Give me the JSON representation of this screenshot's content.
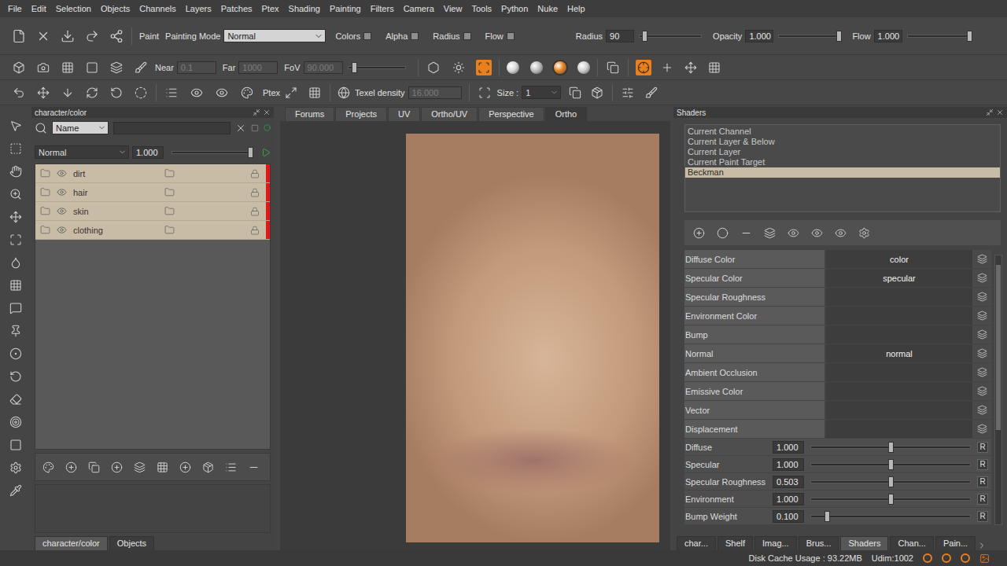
{
  "menu": [
    "File",
    "Edit",
    "Selection",
    "Objects",
    "Channels",
    "Layers",
    "Patches",
    "Ptex",
    "Shading",
    "Painting",
    "Filters",
    "Camera",
    "View",
    "Tools",
    "Python",
    "Nuke",
    "Help"
  ],
  "paint_bar": {
    "paint": "Paint",
    "mode_label": "Painting Mode",
    "mode_value": "Normal",
    "toggles": [
      {
        "label": "Colors",
        "checked": false
      },
      {
        "label": "Alpha",
        "checked": false
      },
      {
        "label": "Radius",
        "checked": false
      },
      {
        "label": "Flow",
        "checked": false
      }
    ],
    "sliders": [
      {
        "label": "Radius",
        "value": "90",
        "level": 0.08
      },
      {
        "label": "Opacity",
        "value": "1.000",
        "level": 0.97
      },
      {
        "label": "Flow",
        "value": "1.000",
        "level": 1.0
      }
    ]
  },
  "camera_bar": {
    "fields": [
      {
        "label": "Near",
        "value": "0.1",
        "disabled": true
      },
      {
        "label": "Far",
        "value": "1000",
        "disabled": true
      },
      {
        "label": "FoV",
        "value": "90.000",
        "disabled": true
      }
    ],
    "fov_level": 0.1,
    "view_modes": [
      {
        "active": false
      },
      {
        "active": false
      },
      {
        "active": true
      }
    ],
    "shading_balls": [
      {
        "color": "#d8d8d8",
        "selected": false
      },
      {
        "color": "#bdbdbd",
        "selected": false
      },
      {
        "color": "#e8801e",
        "selected": true
      },
      {
        "color": "#cfcfcf",
        "selected": false
      }
    ],
    "snap_tools": [
      {
        "active": true
      },
      {
        "active": false
      },
      {
        "active": false
      },
      {
        "active": false
      }
    ]
  },
  "ptex_bar": {
    "ptex": "Ptex",
    "texel_label": "Texel density",
    "texel_value": "16.000",
    "texel_disabled": true,
    "size_label": "Size :",
    "size_value": "1",
    "size_disabled": true
  },
  "layers_panel": {
    "title": "character/color",
    "filter": "Name",
    "search": "",
    "blend": "Normal",
    "opacity": "1.000",
    "opacity_level": 0.97,
    "layers": [
      {
        "name": "dirt",
        "visible": true,
        "locked": false,
        "selected": true
      },
      {
        "name": "hair",
        "visible": true,
        "locked": false,
        "selected": true
      },
      {
        "name": "skin",
        "visible": true,
        "locked": false,
        "selected": true
      },
      {
        "name": "clothing",
        "visible": true,
        "locked": false,
        "selected": true
      }
    ],
    "tabs": [
      {
        "label": "character/color",
        "selected": true
      },
      {
        "label": "Objects",
        "selected": false
      }
    ]
  },
  "viewport": {
    "tabs": [
      {
        "label": "Forums",
        "selected": false
      },
      {
        "label": "Projects",
        "selected": false
      },
      {
        "label": "UV",
        "selected": false
      },
      {
        "label": "Ortho/UV",
        "selected": false
      },
      {
        "label": "Perspective",
        "selected": false
      },
      {
        "label": "Ortho",
        "selected": true
      }
    ]
  },
  "shaders_panel": {
    "title": "Shaders",
    "targets": [
      {
        "label": "Current Channel",
        "selected": false
      },
      {
        "label": "Current Layer & Below",
        "selected": false
      },
      {
        "label": "Current Layer",
        "selected": false
      },
      {
        "label": "Current Paint Target",
        "selected": false
      },
      {
        "label": "Beckman",
        "selected": true
      }
    ],
    "properties": [
      {
        "label": "Diffuse Color",
        "value": "color"
      },
      {
        "label": "Specular Color",
        "value": "specular"
      },
      {
        "label": "Specular Roughness",
        "value": ""
      },
      {
        "label": "Environment Color",
        "value": ""
      },
      {
        "label": "Bump",
        "value": ""
      },
      {
        "label": "Normal",
        "value": "normal"
      },
      {
        "label": "Ambient Occlusion",
        "value": ""
      },
      {
        "label": "Emissive Color",
        "value": ""
      },
      {
        "label": "Vector",
        "value": ""
      },
      {
        "label": "Displacement",
        "value": ""
      }
    ],
    "sliders": [
      {
        "label": "Diffuse",
        "value": "1.000",
        "level": 0.5,
        "reset": "R"
      },
      {
        "label": "Specular",
        "value": "1.000",
        "level": 0.5,
        "reset": "R"
      },
      {
        "label": "Specular Roughness",
        "value": "0.503",
        "level": 0.5,
        "reset": "R"
      },
      {
        "label": "Environment",
        "value": "1.000",
        "level": 0.5,
        "reset": "R"
      },
      {
        "label": "Bump Weight",
        "value": "0.100",
        "level": 0.1,
        "reset": "R"
      }
    ]
  },
  "dock_tabs": [
    {
      "label": "char...",
      "selected": false
    },
    {
      "label": "Shelf",
      "selected": false
    },
    {
      "label": "Imag...",
      "selected": false
    },
    {
      "label": "Brus...",
      "selected": false
    },
    {
      "label": "Shaders",
      "selected": true
    },
    {
      "label": "Chan...",
      "selected": false
    },
    {
      "label": "Pain...",
      "selected": false
    }
  ],
  "status_bar": {
    "disk_cache": "Disk Cache Usage : 93.22MB",
    "udim": "Udim:1002"
  }
}
